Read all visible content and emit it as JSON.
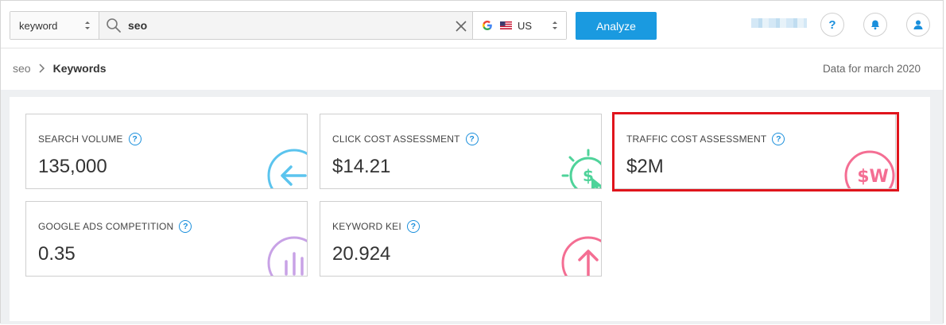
{
  "search": {
    "type_value": "keyword",
    "query_value": "seo",
    "region_value": "US",
    "analyze_label": "Analyze"
  },
  "header": {
    "help_symbol": "?"
  },
  "breadcrumb": {
    "root": "seo",
    "current": "Keywords"
  },
  "data_for": "Data for march 2020",
  "cards": [
    {
      "label": "SEARCH VOLUME",
      "value": "135,000",
      "icon": "arrow-left-icon",
      "color": "#5bc4ee"
    },
    {
      "label": "CLICK COST ASSESSMENT",
      "value": "$14.21",
      "icon": "click-dollar-icon",
      "color": "#4fd39a"
    },
    {
      "label": "TRAFFIC COST ASSESSMENT",
      "value": "$2M",
      "icon": "dollar-w-icon",
      "color": "#f46e93"
    },
    {
      "label": "GOOGLE ADS COMPETITION",
      "value": "0.35",
      "icon": "bar-chart-icon",
      "color": "#c8a2e6"
    },
    {
      "label": "KEYWORD KEI",
      "value": "20.924",
      "icon": "arrow-up-icon",
      "color": "#f46e93"
    }
  ],
  "colors": {
    "accent": "#1a9ae0",
    "highlight": "#e0141c"
  }
}
